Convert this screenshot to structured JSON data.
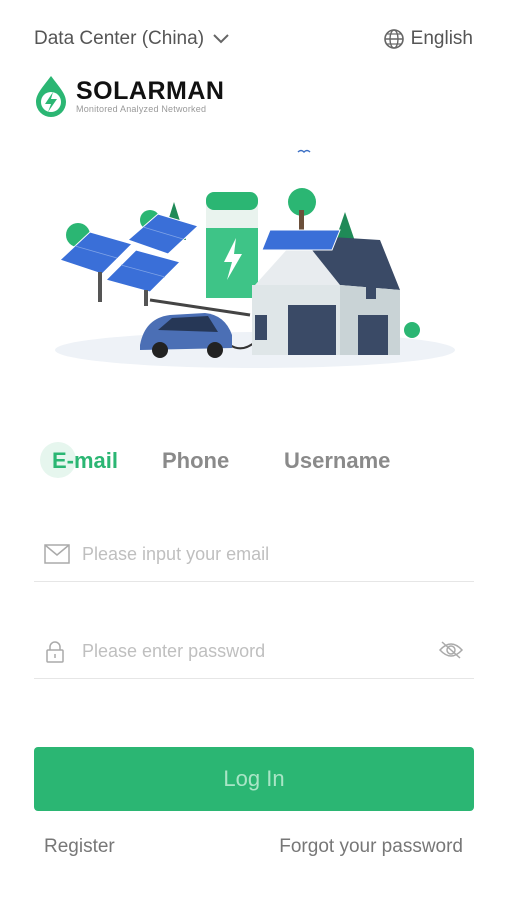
{
  "header": {
    "data_center": "Data Center (China)",
    "language": "English"
  },
  "brand": {
    "name": "SOLARMAN",
    "tagline": "Monitored  Analyzed  Networked",
    "color": "#2bb673"
  },
  "tabs": [
    {
      "label": "E-mail",
      "active": true
    },
    {
      "label": "Phone",
      "active": false
    },
    {
      "label": "Username",
      "active": false
    }
  ],
  "form": {
    "email_placeholder": "Please input your email",
    "password_placeholder": "Please enter password",
    "login_label": "Log In"
  },
  "links": {
    "register": "Register",
    "forgot": "Forgot your password"
  },
  "icons": [
    "chevron-down-icon",
    "globe-icon",
    "mail-icon",
    "lock-icon",
    "eye-off-icon"
  ]
}
